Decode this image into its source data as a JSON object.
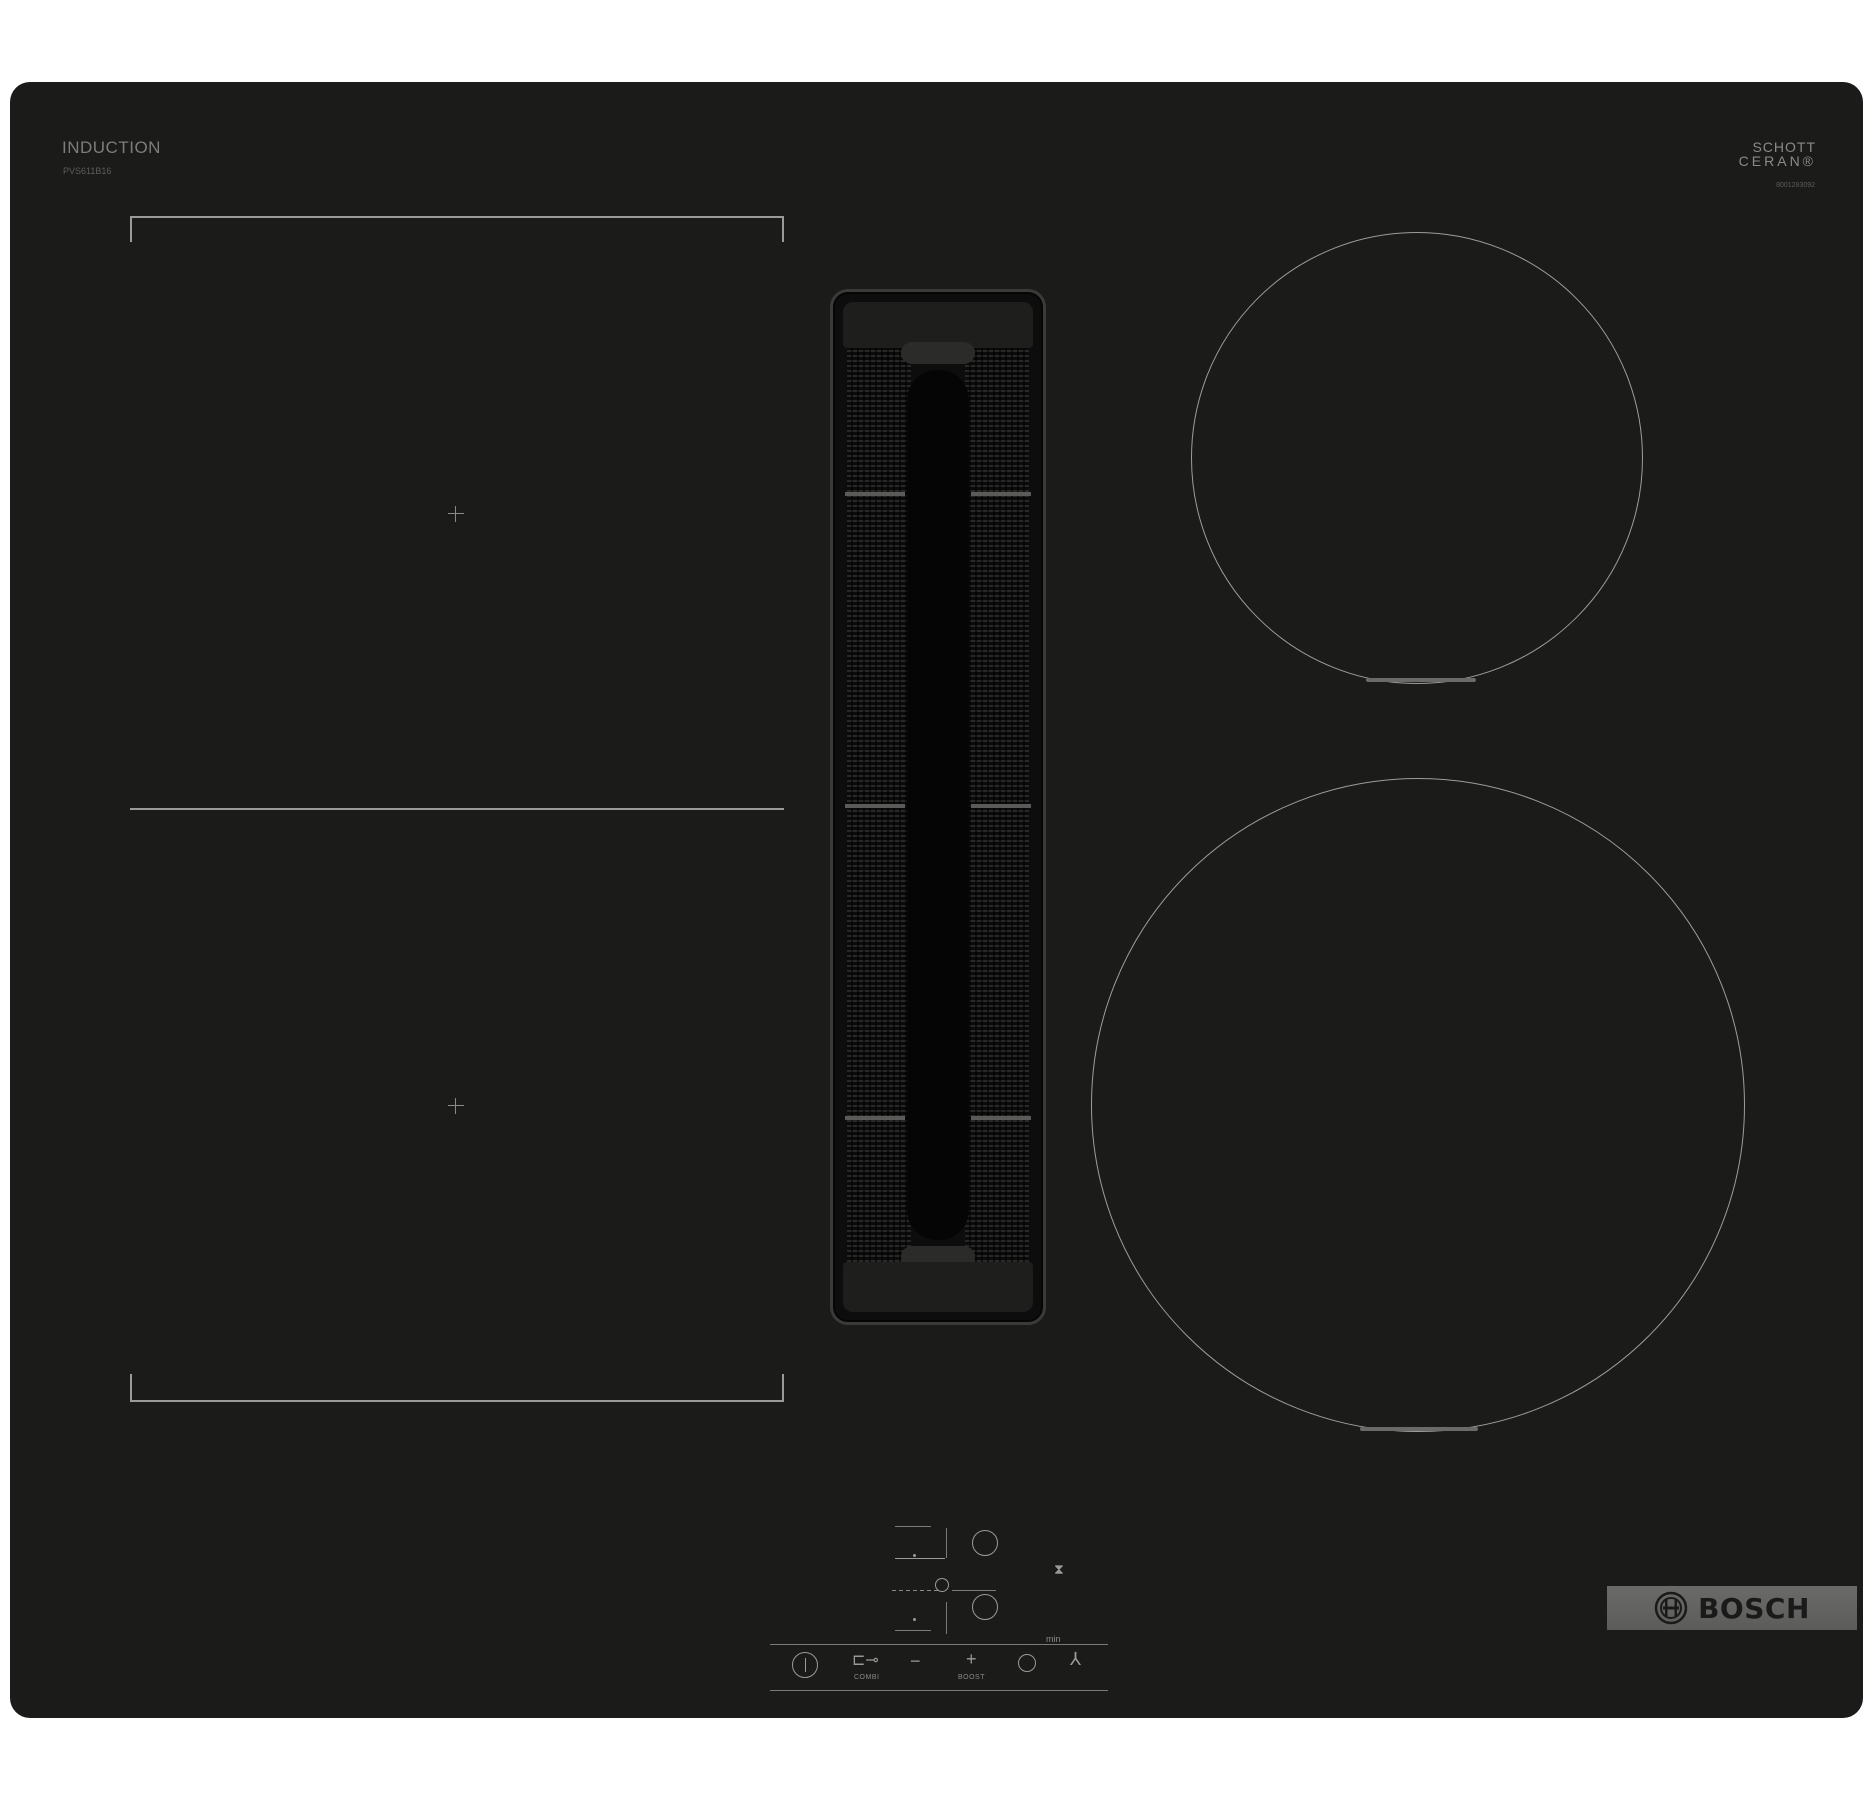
{
  "labels": {
    "technology": "INDUCTION",
    "model": "PVS611B16",
    "glass_brand_line1": "SCHOTT",
    "glass_brand_line2": "CERAN®",
    "serial": "8001283092",
    "timer_unit": "min",
    "combi": "COMBI",
    "boost": "BOOST",
    "brand": "BOSCH"
  },
  "colors": {
    "glass": "#1b1b1a",
    "markings": "#9d9d9b",
    "logo_plate": "#6a6a68"
  },
  "icons": {
    "power": "power-icon",
    "lock": "key-lock-icon",
    "minus": "minus-icon",
    "plus": "plus-icon",
    "timer": "clock-icon",
    "fan": "fan-icon",
    "hourglass": "hourglass-icon",
    "logo": "bosch-logo-icon"
  }
}
